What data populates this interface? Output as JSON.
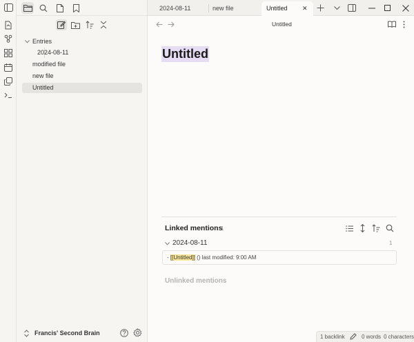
{
  "ribbon": {
    "icons": [
      "sidebar-toggle-icon",
      "file-sync-icon",
      "graph-view-icon",
      "plugins-icon",
      "calendar-icon",
      "copy-icon",
      "terminal-icon"
    ]
  },
  "sidebar": {
    "top_icons": [
      "folder-icon",
      "search-icon",
      "file-icon",
      "bookmark-icon"
    ],
    "tool_icons": [
      "new-note-icon",
      "new-folder-icon",
      "sort-icon",
      "collapse-all-icon"
    ],
    "tree": {
      "folder": "Entries",
      "child": "2024-08-11",
      "files": [
        "modified file",
        "new file",
        "Untitled"
      ]
    },
    "vault_name": "Francis' Second Brain"
  },
  "tabs": [
    {
      "label": "2024-08-11"
    },
    {
      "label": "new file"
    },
    {
      "label": "Untitled",
      "close": "✕"
    }
  ],
  "nav": {
    "title": "Untitled"
  },
  "note": {
    "title": "Untitled"
  },
  "backlinks": {
    "linked_title": "Linked mentions",
    "linked_count": "1",
    "group_name": "2024-08-11",
    "group_count": "1",
    "mention_prefix": "- ",
    "mention_link": "[[Untitled]]",
    "mention_suffix": " () last modified:  9:00 AM",
    "unlinked_title": "Unlinked mentions"
  },
  "status": {
    "backlinks": "1 backlink",
    "words": "0 words",
    "characters": "0 characters"
  },
  "colors": {
    "title_highlight": "#e6dcf4",
    "link_highlight": "#fbe79a"
  }
}
